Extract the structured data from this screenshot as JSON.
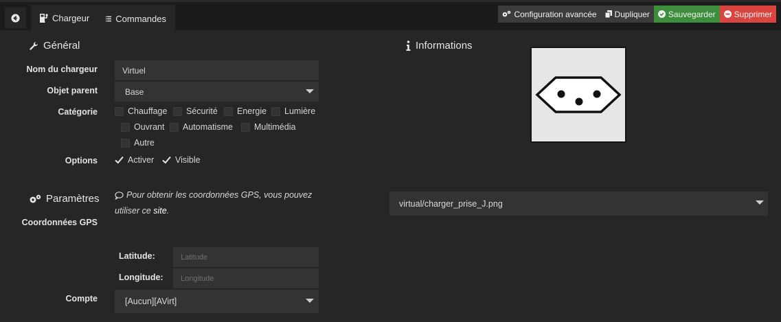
{
  "tabs": [
    {
      "label": "Chargeur"
    },
    {
      "label": "Commandes"
    }
  ],
  "actions": {
    "config": "Configuration avancée",
    "duplicate": "Dupliquer",
    "save": "Sauvegarder",
    "delete": "Supprimer"
  },
  "general": {
    "title": "Général",
    "name_label": "Nom du chargeur",
    "name_value": "Virtuel",
    "parent_label": "Objet parent",
    "parent_value": "Base",
    "category_label": "Catégorie",
    "categories": [
      "Chauffage",
      "Sécurité",
      "Energie",
      "Lumière",
      "Ouvrant",
      "Automatisme",
      "Multimédia",
      "Autre"
    ],
    "options_label": "Options",
    "options": [
      "Activer",
      "Visible"
    ]
  },
  "params": {
    "title": "Paramètres",
    "gps_label": "Coordonnées GPS",
    "gps_help_1": "Pour obtenir les coordonnées GPS, vous pouvez",
    "gps_help_2": "utiliser ce",
    "gps_link": "site",
    "latitude_label": "Latitude:",
    "latitude_placeholder": "Latitude",
    "longitude_label": "Longitude:",
    "longitude_placeholder": "Longitude",
    "account_label": "Compte",
    "account_value": "[Aucun][AVirt]"
  },
  "info": {
    "title": "Informations",
    "image_value": "virtual/charger_prise_J.png"
  },
  "colors": {
    "accent": "#8cbf3f",
    "save": "#3c8d3c",
    "delete": "#d9443f"
  }
}
